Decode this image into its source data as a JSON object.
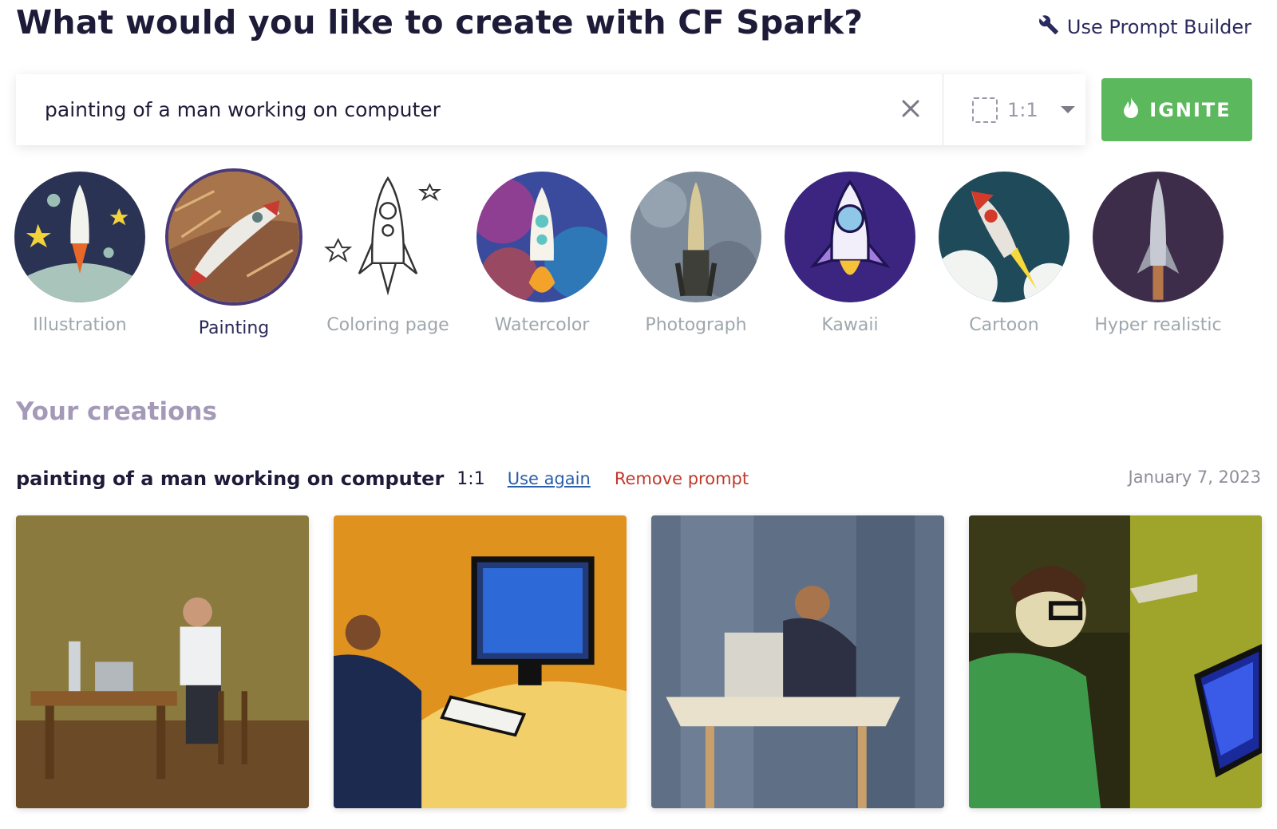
{
  "header": {
    "title": "What would you like to create with CF Spark?",
    "prompt_builder_label": "Use Prompt Builder",
    "prompt_builder_icon": "wrench-icon"
  },
  "search": {
    "value": "painting of a man working on computer",
    "clear_icon": "close-icon",
    "ratio": "1:1",
    "ignite_label": "IGNITE",
    "ignite_icon": "flame-icon",
    "ignite_color": "#5cb85c"
  },
  "styles": [
    {
      "label": "Illustration",
      "selected": false
    },
    {
      "label": "Painting",
      "selected": true
    },
    {
      "label": "Coloring page",
      "selected": false
    },
    {
      "label": "Watercolor",
      "selected": false
    },
    {
      "label": "Photograph",
      "selected": false
    },
    {
      "label": "Kawaii",
      "selected": false
    },
    {
      "label": "Cartoon",
      "selected": false
    },
    {
      "label": "Hyper realistic",
      "selected": false
    }
  ],
  "creations": {
    "title": "Your creations",
    "prompt": "painting of a man working on computer",
    "ratio": "1:1",
    "use_again_label": "Use again",
    "remove_label": "Remove prompt",
    "date": "January 7, 2023",
    "image_count": 4
  },
  "colors": {
    "accent": "#4a3a78",
    "title": "#1e1b39",
    "muted": "#9ea7ad",
    "remove": "#c0392b",
    "link": "#2a5ea8"
  }
}
